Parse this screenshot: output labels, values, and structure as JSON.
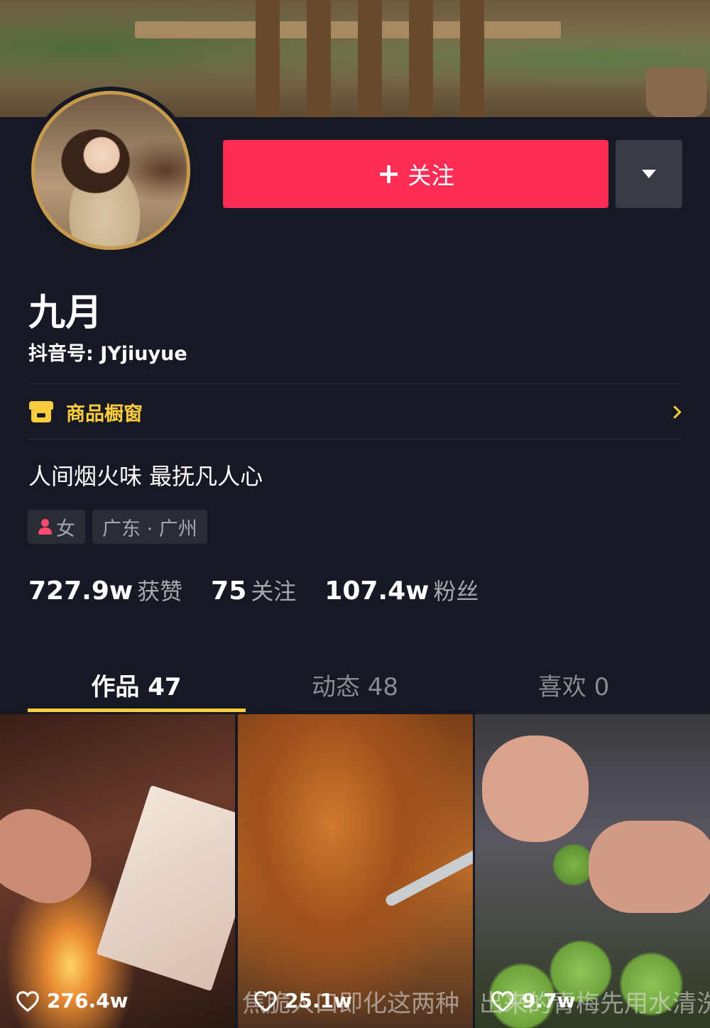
{
  "profile": {
    "name": "九月",
    "douyin_id": "抖音号: JYjiuyue",
    "bio": "人间烟火味 最抚凡人心",
    "follow_button": "关注",
    "follow_plus": "+",
    "shop_label": "商品橱窗",
    "tags": {
      "gender": "女",
      "location": "广东 · 广州"
    },
    "stats": [
      {
        "value": "727.9w",
        "label": "获赞"
      },
      {
        "value": "75",
        "label": "关注"
      },
      {
        "value": "107.4w",
        "label": "粉丝"
      }
    ]
  },
  "tabs": [
    {
      "label": "作品 47",
      "active": true
    },
    {
      "label": "动态 48",
      "active": false
    },
    {
      "label": "喜欢 0",
      "active": false
    }
  ],
  "videos": [
    {
      "likes": "276.4w",
      "caption": ""
    },
    {
      "likes": "25.1w",
      "caption": "焦脆人口即化这两种"
    },
    {
      "likes": "9.7w",
      "caption": "出来的青梅先用水清洗"
    }
  ],
  "colors": {
    "background": "#161823",
    "follow_red": "#fe2c55",
    "shop_yellow": "#facd3f",
    "tab_underline": "#facd3f"
  },
  "icons": [
    "shop-icon",
    "chevron-right-icon",
    "female-icon",
    "heart-icon",
    "dropdown-triangle-icon"
  ]
}
